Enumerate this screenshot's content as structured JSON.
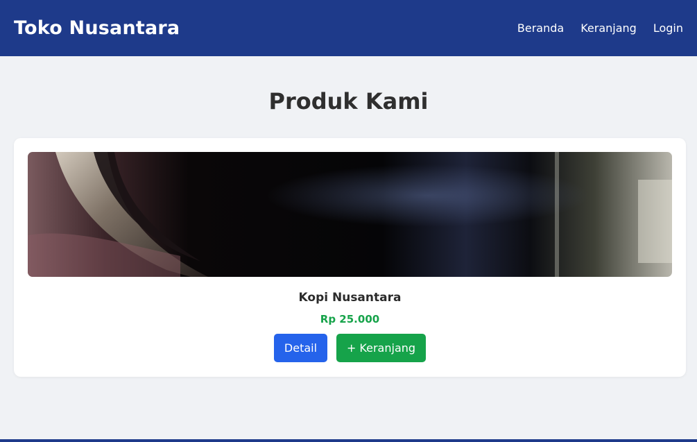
{
  "navbar": {
    "brand": "Toko Nusantara",
    "links": [
      "Beranda",
      "Keranjang",
      "Login"
    ]
  },
  "main": {
    "title": "Produk Kami",
    "products": [
      {
        "name": "Kopi Nusantara",
        "price": "Rp 25.000",
        "detail_label": "Detail",
        "cart_label": "+ Keranjang",
        "image": "coffee-cup-closeup-photo"
      }
    ]
  },
  "colors": {
    "navbar": "#1e3a8a",
    "price": "#16a34a",
    "detail_button": "#2563eb",
    "cart_button": "#16a34a",
    "background": "#f0f2f5"
  }
}
